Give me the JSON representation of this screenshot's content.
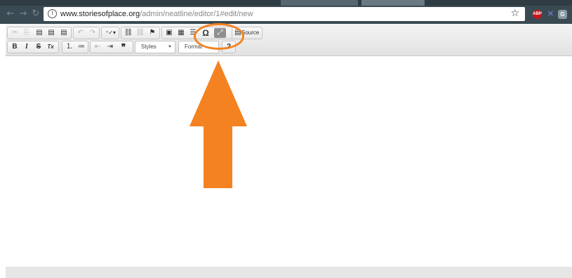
{
  "browser": {
    "url_host": "www.storiesofplace.org",
    "url_path": "/admin/neatline/editor/1#edit/new",
    "info_icon": "info-icon",
    "star_icon": "bookmark-star-icon",
    "extensions": [
      {
        "name": "adblock-icon",
        "label": "ABP",
        "color": "#c4161c"
      },
      {
        "name": "x-extension-icon",
        "label": "✕",
        "color": "#7a6bd1"
      },
      {
        "name": "g-extension-icon",
        "label": "G",
        "color": "#8a9aa2"
      }
    ],
    "back_glyph": "←",
    "forward_glyph": "→",
    "reload_glyph": "↻"
  },
  "toolbar": {
    "row1": {
      "cut": "✂",
      "copy": "⎘",
      "paste": "▤",
      "paste_text": "▤",
      "paste_word": "▤",
      "undo": "↶",
      "redo": "↷",
      "spellcheck": "ᴬ✓▾",
      "link": "⛓",
      "unlink": "⛓",
      "anchor": "⚑",
      "image": "▣",
      "table": "▦",
      "hline": "☰",
      "special_char": "Ω",
      "maximize": "⤢",
      "source_icon": "▤",
      "source_label": "Source"
    },
    "row2": {
      "bold": "B",
      "italic": "I",
      "strike": "S",
      "remove_format": "Tx",
      "numbered_list": "⒈",
      "bulleted_list": "≔",
      "outdent": "⇤",
      "indent": "⇥",
      "blockquote": "❞",
      "styles_label": "Styles",
      "format_label": "Format",
      "about": "?"
    }
  },
  "annotation": {
    "color": "#f58220"
  }
}
